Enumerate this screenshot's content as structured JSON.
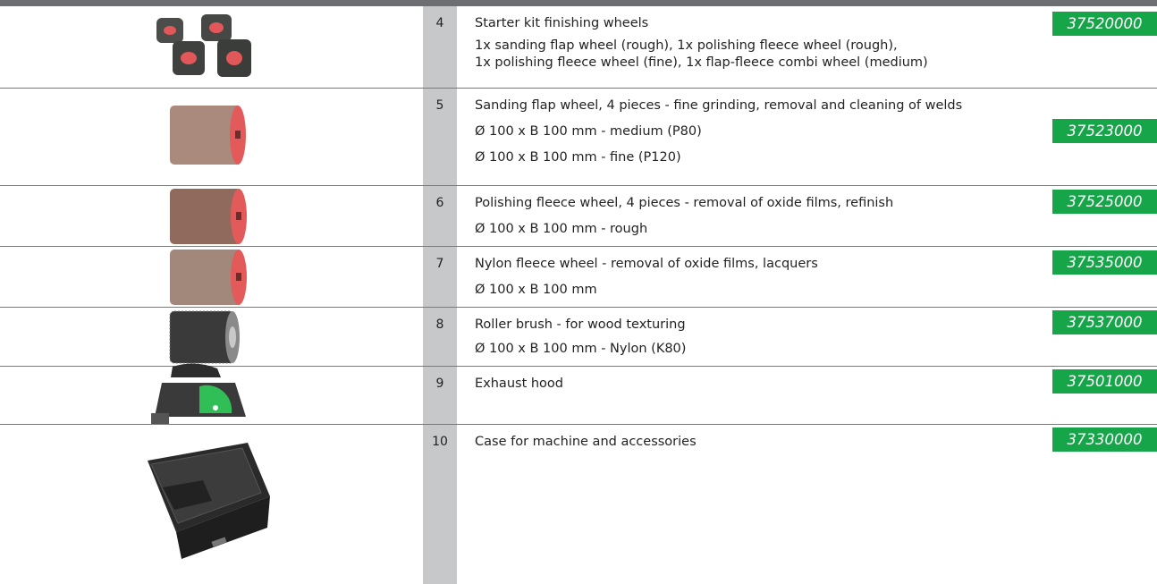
{
  "rows": [
    {
      "num": "4",
      "lines": [
        "Starter kit finishing wheels",
        "1x sanding flap wheel (rough), 1x polishing fleece wheel (rough),",
        "1x polishing fleece wheel (fine), 1x flap-fleece combi wheel (medium)"
      ],
      "code": "37520000"
    },
    {
      "num": "5",
      "lines": [
        "Sanding flap wheel, 4 pieces - fine grinding, removal and cleaning of welds",
        "Ø 100 x B 100 mm - medium (P80)",
        "Ø 100 x B 100 mm - fine (P120)"
      ],
      "code": "37523000"
    },
    {
      "num": "6",
      "lines": [
        "Polishing fleece wheel, 4 pieces - removal of oxide films, refinish",
        "Ø 100 x B 100 mm - rough"
      ],
      "code": "37525000"
    },
    {
      "num": "7",
      "lines": [
        "Nylon fleece wheel - removal of oxide films, lacquers",
        "Ø 100 x B 100 mm"
      ],
      "code": "37535000"
    },
    {
      "num": "8",
      "lines": [
        "Roller brush - for wood texturing",
        "Ø 100 x B 100 mm - Nylon (K80)"
      ],
      "code": "37537000"
    },
    {
      "num": "9",
      "lines": [
        "Exhaust hood"
      ],
      "code": "37501000"
    },
    {
      "num": "10",
      "lines": [
        "Case for machine and accessories"
      ],
      "code": "37330000"
    }
  ],
  "colors": {
    "code_bg": "#17a54a",
    "num_bg": "#c7c8ca",
    "bar": "#6d6e71"
  }
}
